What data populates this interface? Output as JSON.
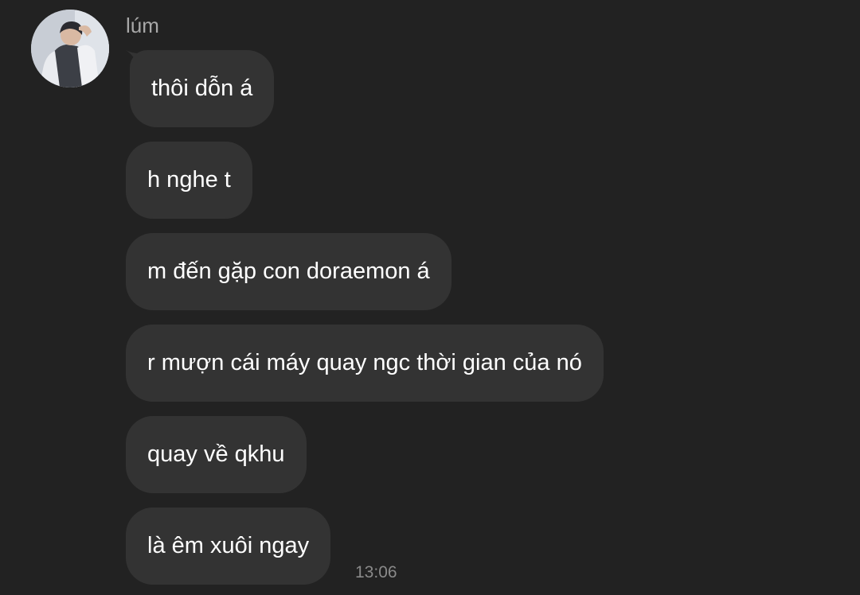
{
  "conversation": {
    "sender_name": "lúm",
    "avatar": "profile-photo-avatar",
    "messages": [
      {
        "text": "thôi dỗn á"
      },
      {
        "text": "h nghe t"
      },
      {
        "text": "m đến gặp con doraemon á"
      },
      {
        "text": "r mượn cái máy quay ngc thời gian của nó"
      },
      {
        "text": "quay về qkhu"
      },
      {
        "text": "là êm xuôi ngay"
      }
    ],
    "last_timestamp": "13:06"
  },
  "colors": {
    "background": "#222222",
    "bubble": "#333333",
    "text": "#ffffff",
    "sender_name": "#a8a8a8",
    "timestamp": "#8a8a8a"
  }
}
